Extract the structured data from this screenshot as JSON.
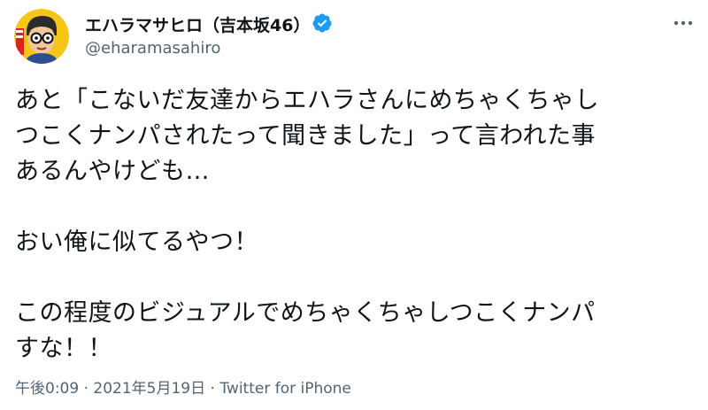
{
  "author": {
    "display_name": "エハラマサヒロ（吉本坂46）",
    "handle": "@eharamasahiro",
    "avatar_icon": "avatar-illustration",
    "verified_icon": "verified-badge-icon",
    "verified_color": "#1d9bf0"
  },
  "tweet": {
    "lines": [
      "あと「こないだ友達からエハラさんにめちゃくちゃし",
      "つこくナンパされたって聞きました」って言われた事",
      "あるんやけども…",
      "",
      "おい俺に似てるやつ！",
      "",
      "この程度のビジュアルでめちゃくちゃしつこくナンパ",
      "すな！！"
    ]
  },
  "meta": {
    "time": "午後0:09",
    "separator": "·",
    "date": "2021年5月19日",
    "source": "Twitter for iPhone"
  },
  "colors": {
    "text": "#0f1419",
    "secondary": "#536471",
    "background": "#ffffff"
  },
  "more_icon": "more-horizontal-icon"
}
